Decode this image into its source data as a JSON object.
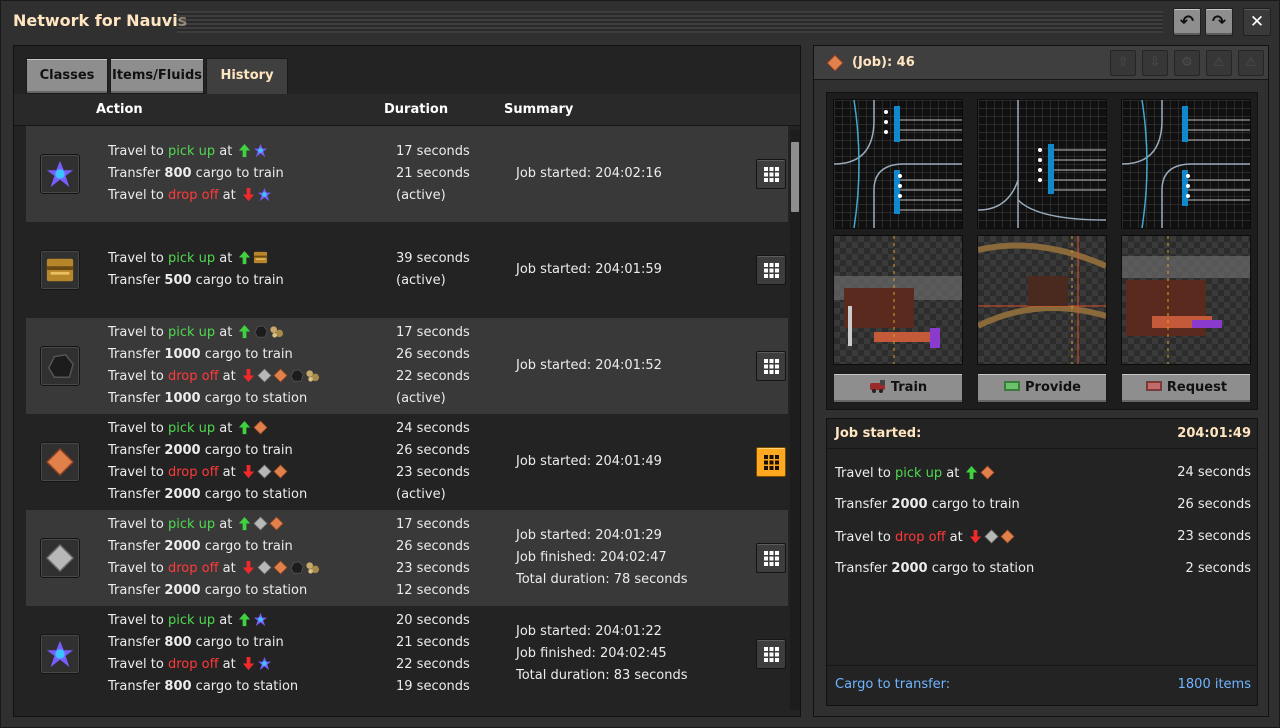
{
  "window": {
    "title": "Network for Nauvis"
  },
  "tabs": [
    "Classes",
    "Items/Fluids",
    "History"
  ],
  "columns": {
    "action": "Action",
    "duration": "Duration",
    "summary": "Summary"
  },
  "rows": [
    {
      "item_icon": "purple-crystal-icon",
      "actions": [
        {
          "type": "travel",
          "pre": "Travel to ",
          "kw": "pick up",
          "mid": " at ",
          "icons": [
            "arrow-up-icon",
            "purple-crystal-icon"
          ]
        },
        {
          "type": "transfer",
          "pre": "Transfer ",
          "amount": "800",
          "post": " cargo to train"
        },
        {
          "type": "travel",
          "pre": "Travel to ",
          "kw": "drop off",
          "mid": " at ",
          "icons": [
            "arrow-down-icon",
            "purple-crystal-icon"
          ]
        }
      ],
      "durations": [
        "17 seconds",
        "21 seconds",
        "(active)"
      ],
      "summary": [
        "Job started: 204:02:16"
      ],
      "selected": false
    },
    {
      "item_icon": "wooden-chest-icon",
      "actions": [
        {
          "type": "travel",
          "pre": "Travel to ",
          "kw": "pick up",
          "mid": " at ",
          "icons": [
            "arrow-up-icon",
            "wooden-chest-icon"
          ]
        },
        {
          "type": "transfer",
          "pre": "Transfer ",
          "amount": "500",
          "post": " cargo to train"
        }
      ],
      "durations": [
        "39 seconds",
        "(active)"
      ],
      "summary": [
        "Job started: 204:01:59"
      ],
      "selected": false
    },
    {
      "item_icon": "coal-icon",
      "actions": [
        {
          "type": "travel",
          "pre": "Travel to ",
          "kw": "pick up",
          "mid": " at ",
          "icons": [
            "arrow-up-icon",
            "coal-icon",
            "stone-icon"
          ]
        },
        {
          "type": "transfer",
          "pre": "Transfer ",
          "amount": "1000",
          "post": " cargo to train"
        },
        {
          "type": "travel",
          "pre": "Travel to ",
          "kw": "drop off",
          "mid": " at ",
          "icons": [
            "arrow-down-icon",
            "iron-plate-icon",
            "copper-plate-icon",
            "coal-icon",
            "stone-icon"
          ]
        },
        {
          "type": "transfer",
          "pre": "Transfer ",
          "amount": "1000",
          "post": " cargo to station"
        }
      ],
      "durations": [
        "17 seconds",
        "26 seconds",
        "22 seconds",
        "(active)"
      ],
      "summary": [
        "Job started: 204:01:52"
      ],
      "selected": false
    },
    {
      "item_icon": "copper-plate-icon",
      "actions": [
        {
          "type": "travel",
          "pre": "Travel to ",
          "kw": "pick up",
          "mid": " at ",
          "icons": [
            "arrow-up-icon",
            "copper-plate-icon"
          ]
        },
        {
          "type": "transfer",
          "pre": "Transfer ",
          "amount": "2000",
          "post": " cargo to train"
        },
        {
          "type": "travel",
          "pre": "Travel to ",
          "kw": "drop off",
          "mid": " at ",
          "icons": [
            "arrow-down-icon",
            "iron-plate-icon",
            "copper-plate-icon"
          ]
        },
        {
          "type": "transfer",
          "pre": "Transfer ",
          "amount": "2000",
          "post": " cargo to station"
        }
      ],
      "durations": [
        "24 seconds",
        "26 seconds",
        "23 seconds",
        "(active)"
      ],
      "summary": [
        "Job started: 204:01:49"
      ],
      "selected": true
    },
    {
      "item_icon": "iron-plate-icon",
      "actions": [
        {
          "type": "travel",
          "pre": "Travel to ",
          "kw": "pick up",
          "mid": " at ",
          "icons": [
            "arrow-up-icon",
            "iron-plate-icon",
            "copper-plate-icon"
          ]
        },
        {
          "type": "transfer",
          "pre": "Transfer ",
          "amount": "2000",
          "post": " cargo to train"
        },
        {
          "type": "travel",
          "pre": "Travel to ",
          "kw": "drop off",
          "mid": " at ",
          "icons": [
            "arrow-down-icon",
            "iron-plate-icon",
            "copper-plate-icon",
            "coal-icon",
            "stone-icon"
          ]
        },
        {
          "type": "transfer",
          "pre": "Transfer ",
          "amount": "2000",
          "post": " cargo to station"
        }
      ],
      "durations": [
        "17 seconds",
        "26 seconds",
        "23 seconds",
        "12 seconds"
      ],
      "summary": [
        "Job started: 204:01:29",
        "Job finished: 204:02:47",
        "Total duration: 78 seconds"
      ],
      "selected": false
    },
    {
      "item_icon": "purple-crystal-icon",
      "actions": [
        {
          "type": "travel",
          "pre": "Travel to ",
          "kw": "pick up",
          "mid": " at ",
          "icons": [
            "arrow-up-icon",
            "purple-crystal-icon"
          ]
        },
        {
          "type": "transfer",
          "pre": "Transfer ",
          "amount": "800",
          "post": " cargo to train"
        },
        {
          "type": "travel",
          "pre": "Travel to ",
          "kw": "drop off",
          "mid": " at ",
          "icons": [
            "arrow-down-icon",
            "purple-crystal-icon"
          ]
        },
        {
          "type": "transfer",
          "pre": "Transfer ",
          "amount": "800",
          "post": " cargo to station"
        }
      ],
      "durations": [
        "20 seconds",
        "21 seconds",
        "22 seconds",
        "19 seconds"
      ],
      "summary": [
        "Job started: 204:01:22",
        "Job finished: 204:02:45",
        "Total duration: 83 seconds"
      ],
      "selected": false
    }
  ],
  "detail": {
    "icon": "copper-plate-icon",
    "title": "(Job): 46",
    "camera_buttons": [
      "Train",
      "Provide",
      "Request"
    ],
    "job_started_label": "Job started:",
    "job_started_value": "204:01:49",
    "lines": [
      {
        "type": "travel",
        "pre": "Travel to ",
        "kw": "pick up",
        "mid": " at ",
        "icons": [
          "arrow-up-icon",
          "copper-plate-icon"
        ],
        "value": "24 seconds"
      },
      {
        "type": "transfer",
        "pre": "Transfer ",
        "amount": "2000",
        "post": " cargo to train",
        "value": "26 seconds"
      },
      {
        "type": "travel",
        "pre": "Travel to ",
        "kw": "drop off",
        "mid": " at ",
        "icons": [
          "arrow-down-icon",
          "iron-plate-icon",
          "copper-plate-icon"
        ],
        "value": "23 seconds"
      },
      {
        "type": "transfer",
        "pre": "Transfer ",
        "amount": "2000",
        "post": " cargo to station",
        "value": "2 seconds"
      }
    ],
    "cargo_label": "Cargo to transfer:",
    "cargo_value": "1800 items"
  },
  "colors": {
    "pickup": "#4fd84f",
    "dropoff": "#ff3a3a",
    "accent": "#ffa820",
    "cargo": "#6fb5ff"
  }
}
